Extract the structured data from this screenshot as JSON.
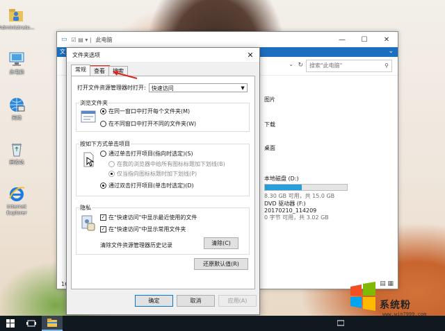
{
  "desktop": {
    "icons": [
      {
        "label": "Administrato...",
        "icon": "user-folder-icon"
      },
      {
        "label": "此电脑",
        "icon": "computer-icon"
      },
      {
        "label": "网络",
        "icon": "network-icon"
      },
      {
        "label": "回收站",
        "icon": "recycle-bin-icon"
      },
      {
        "label": "Internet Explorer",
        "icon": "ie-icon"
      }
    ]
  },
  "explorer": {
    "title": "此电脑",
    "ribbon_tab": "文",
    "search_placeholder": "搜索\"此电脑\"",
    "items": [
      {
        "name": "图片"
      },
      {
        "name": "下载"
      },
      {
        "name": "桌面"
      }
    ],
    "drives": [
      {
        "name": "本地磁盘 (D:)",
        "free": "8.30 GB 可用，共 15.0 GB",
        "used_fraction": 0.45
      },
      {
        "name": "DVD 驱动器 (F:)",
        "label": "20170210_114209",
        "free": "0 字节 可用，共 3.02 GB"
      }
    ],
    "status_text": "16"
  },
  "dialog": {
    "title": "文件夹选项",
    "tabs": [
      "常规",
      "查看",
      "搜索"
    ],
    "open_label": "打开文件资源管理器时打开:",
    "open_value": "快速访问",
    "browse": {
      "legend": "浏览文件夹",
      "opt1": "在同一窗口中打开每个文件夹(M)",
      "opt2": "在不同窗口中打开不同的文件夹(W)"
    },
    "click": {
      "legend": "按如下方式单击项目",
      "opt1": "通过单击打开项目(指向时选定)(S)",
      "sub1": "在我的浏览器中给所有图标标题加下划线(B)",
      "sub2": "仅当指向图标标题时加下划线(P)",
      "opt2": "通过双击打开项目(单击时选定)(D)"
    },
    "privacy": {
      "legend": "隐私",
      "check1": "在\"快速访问\"中显示最近使用的文件",
      "check2": "在\"快速访问\"中显示常用文件夹",
      "clear_label": "清除文件资源管理器历史记录",
      "clear_button": "清除(C)"
    },
    "restore_button": "还原默认值(R)",
    "ok": "确定",
    "cancel": "取消",
    "apply": "应用(A)"
  },
  "watermark": {
    "text": "系统粉",
    "url": "www.win7999.com"
  }
}
